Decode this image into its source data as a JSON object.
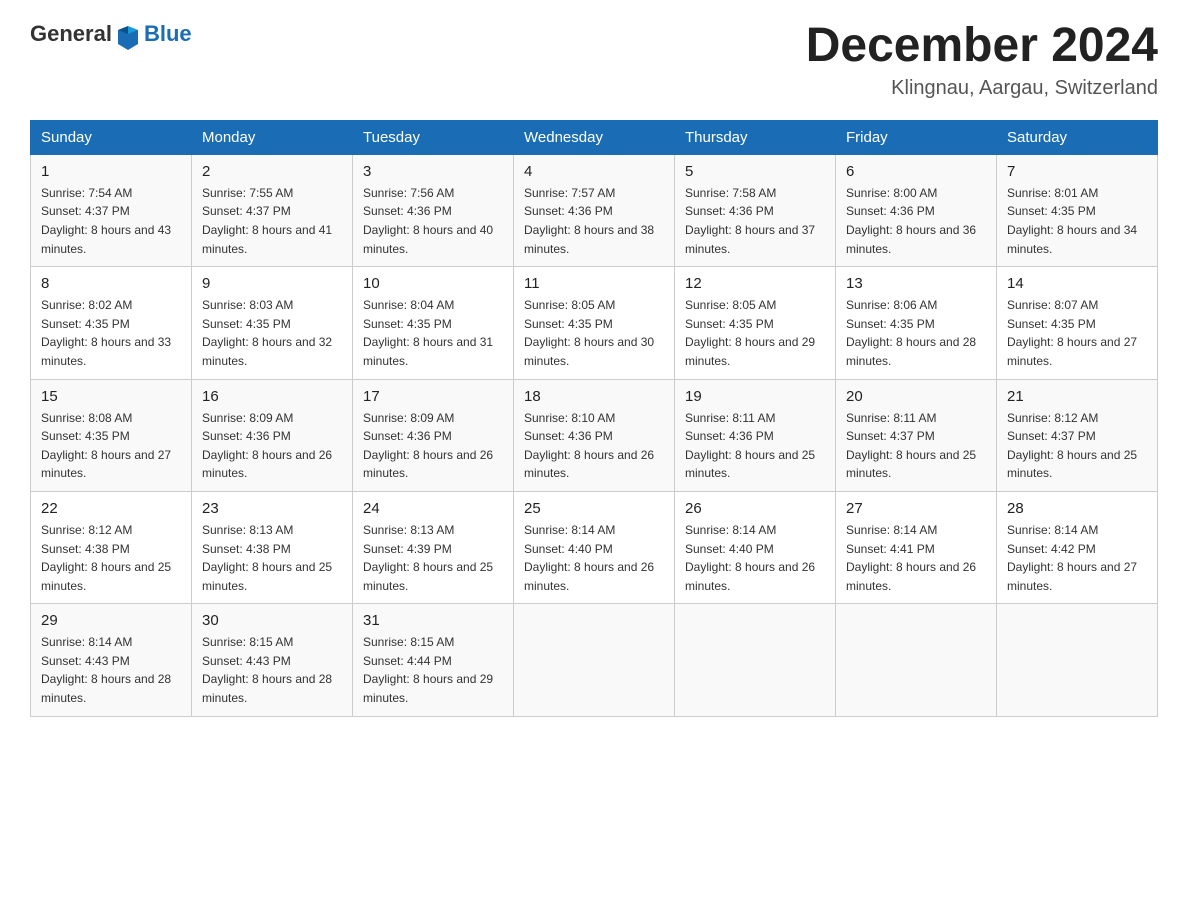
{
  "header": {
    "logo_general": "General",
    "logo_blue": "Blue",
    "month_title": "December 2024",
    "location": "Klingnau, Aargau, Switzerland"
  },
  "days_of_week": [
    "Sunday",
    "Monday",
    "Tuesday",
    "Wednesday",
    "Thursday",
    "Friday",
    "Saturday"
  ],
  "weeks": [
    [
      {
        "day": "1",
        "sunrise": "7:54 AM",
        "sunset": "4:37 PM",
        "daylight": "8 hours and 43 minutes."
      },
      {
        "day": "2",
        "sunrise": "7:55 AM",
        "sunset": "4:37 PM",
        "daylight": "8 hours and 41 minutes."
      },
      {
        "day": "3",
        "sunrise": "7:56 AM",
        "sunset": "4:36 PM",
        "daylight": "8 hours and 40 minutes."
      },
      {
        "day": "4",
        "sunrise": "7:57 AM",
        "sunset": "4:36 PM",
        "daylight": "8 hours and 38 minutes."
      },
      {
        "day": "5",
        "sunrise": "7:58 AM",
        "sunset": "4:36 PM",
        "daylight": "8 hours and 37 minutes."
      },
      {
        "day": "6",
        "sunrise": "8:00 AM",
        "sunset": "4:36 PM",
        "daylight": "8 hours and 36 minutes."
      },
      {
        "day": "7",
        "sunrise": "8:01 AM",
        "sunset": "4:35 PM",
        "daylight": "8 hours and 34 minutes."
      }
    ],
    [
      {
        "day": "8",
        "sunrise": "8:02 AM",
        "sunset": "4:35 PM",
        "daylight": "8 hours and 33 minutes."
      },
      {
        "day": "9",
        "sunrise": "8:03 AM",
        "sunset": "4:35 PM",
        "daylight": "8 hours and 32 minutes."
      },
      {
        "day": "10",
        "sunrise": "8:04 AM",
        "sunset": "4:35 PM",
        "daylight": "8 hours and 31 minutes."
      },
      {
        "day": "11",
        "sunrise": "8:05 AM",
        "sunset": "4:35 PM",
        "daylight": "8 hours and 30 minutes."
      },
      {
        "day": "12",
        "sunrise": "8:05 AM",
        "sunset": "4:35 PM",
        "daylight": "8 hours and 29 minutes."
      },
      {
        "day": "13",
        "sunrise": "8:06 AM",
        "sunset": "4:35 PM",
        "daylight": "8 hours and 28 minutes."
      },
      {
        "day": "14",
        "sunrise": "8:07 AM",
        "sunset": "4:35 PM",
        "daylight": "8 hours and 27 minutes."
      }
    ],
    [
      {
        "day": "15",
        "sunrise": "8:08 AM",
        "sunset": "4:35 PM",
        "daylight": "8 hours and 27 minutes."
      },
      {
        "day": "16",
        "sunrise": "8:09 AM",
        "sunset": "4:36 PM",
        "daylight": "8 hours and 26 minutes."
      },
      {
        "day": "17",
        "sunrise": "8:09 AM",
        "sunset": "4:36 PM",
        "daylight": "8 hours and 26 minutes."
      },
      {
        "day": "18",
        "sunrise": "8:10 AM",
        "sunset": "4:36 PM",
        "daylight": "8 hours and 26 minutes."
      },
      {
        "day": "19",
        "sunrise": "8:11 AM",
        "sunset": "4:36 PM",
        "daylight": "8 hours and 25 minutes."
      },
      {
        "day": "20",
        "sunrise": "8:11 AM",
        "sunset": "4:37 PM",
        "daylight": "8 hours and 25 minutes."
      },
      {
        "day": "21",
        "sunrise": "8:12 AM",
        "sunset": "4:37 PM",
        "daylight": "8 hours and 25 minutes."
      }
    ],
    [
      {
        "day": "22",
        "sunrise": "8:12 AM",
        "sunset": "4:38 PM",
        "daylight": "8 hours and 25 minutes."
      },
      {
        "day": "23",
        "sunrise": "8:13 AM",
        "sunset": "4:38 PM",
        "daylight": "8 hours and 25 minutes."
      },
      {
        "day": "24",
        "sunrise": "8:13 AM",
        "sunset": "4:39 PM",
        "daylight": "8 hours and 25 minutes."
      },
      {
        "day": "25",
        "sunrise": "8:14 AM",
        "sunset": "4:40 PM",
        "daylight": "8 hours and 26 minutes."
      },
      {
        "day": "26",
        "sunrise": "8:14 AM",
        "sunset": "4:40 PM",
        "daylight": "8 hours and 26 minutes."
      },
      {
        "day": "27",
        "sunrise": "8:14 AM",
        "sunset": "4:41 PM",
        "daylight": "8 hours and 26 minutes."
      },
      {
        "day": "28",
        "sunrise": "8:14 AM",
        "sunset": "4:42 PM",
        "daylight": "8 hours and 27 minutes."
      }
    ],
    [
      {
        "day": "29",
        "sunrise": "8:14 AM",
        "sunset": "4:43 PM",
        "daylight": "8 hours and 28 minutes."
      },
      {
        "day": "30",
        "sunrise": "8:15 AM",
        "sunset": "4:43 PM",
        "daylight": "8 hours and 28 minutes."
      },
      {
        "day": "31",
        "sunrise": "8:15 AM",
        "sunset": "4:44 PM",
        "daylight": "8 hours and 29 minutes."
      },
      null,
      null,
      null,
      null
    ]
  ]
}
